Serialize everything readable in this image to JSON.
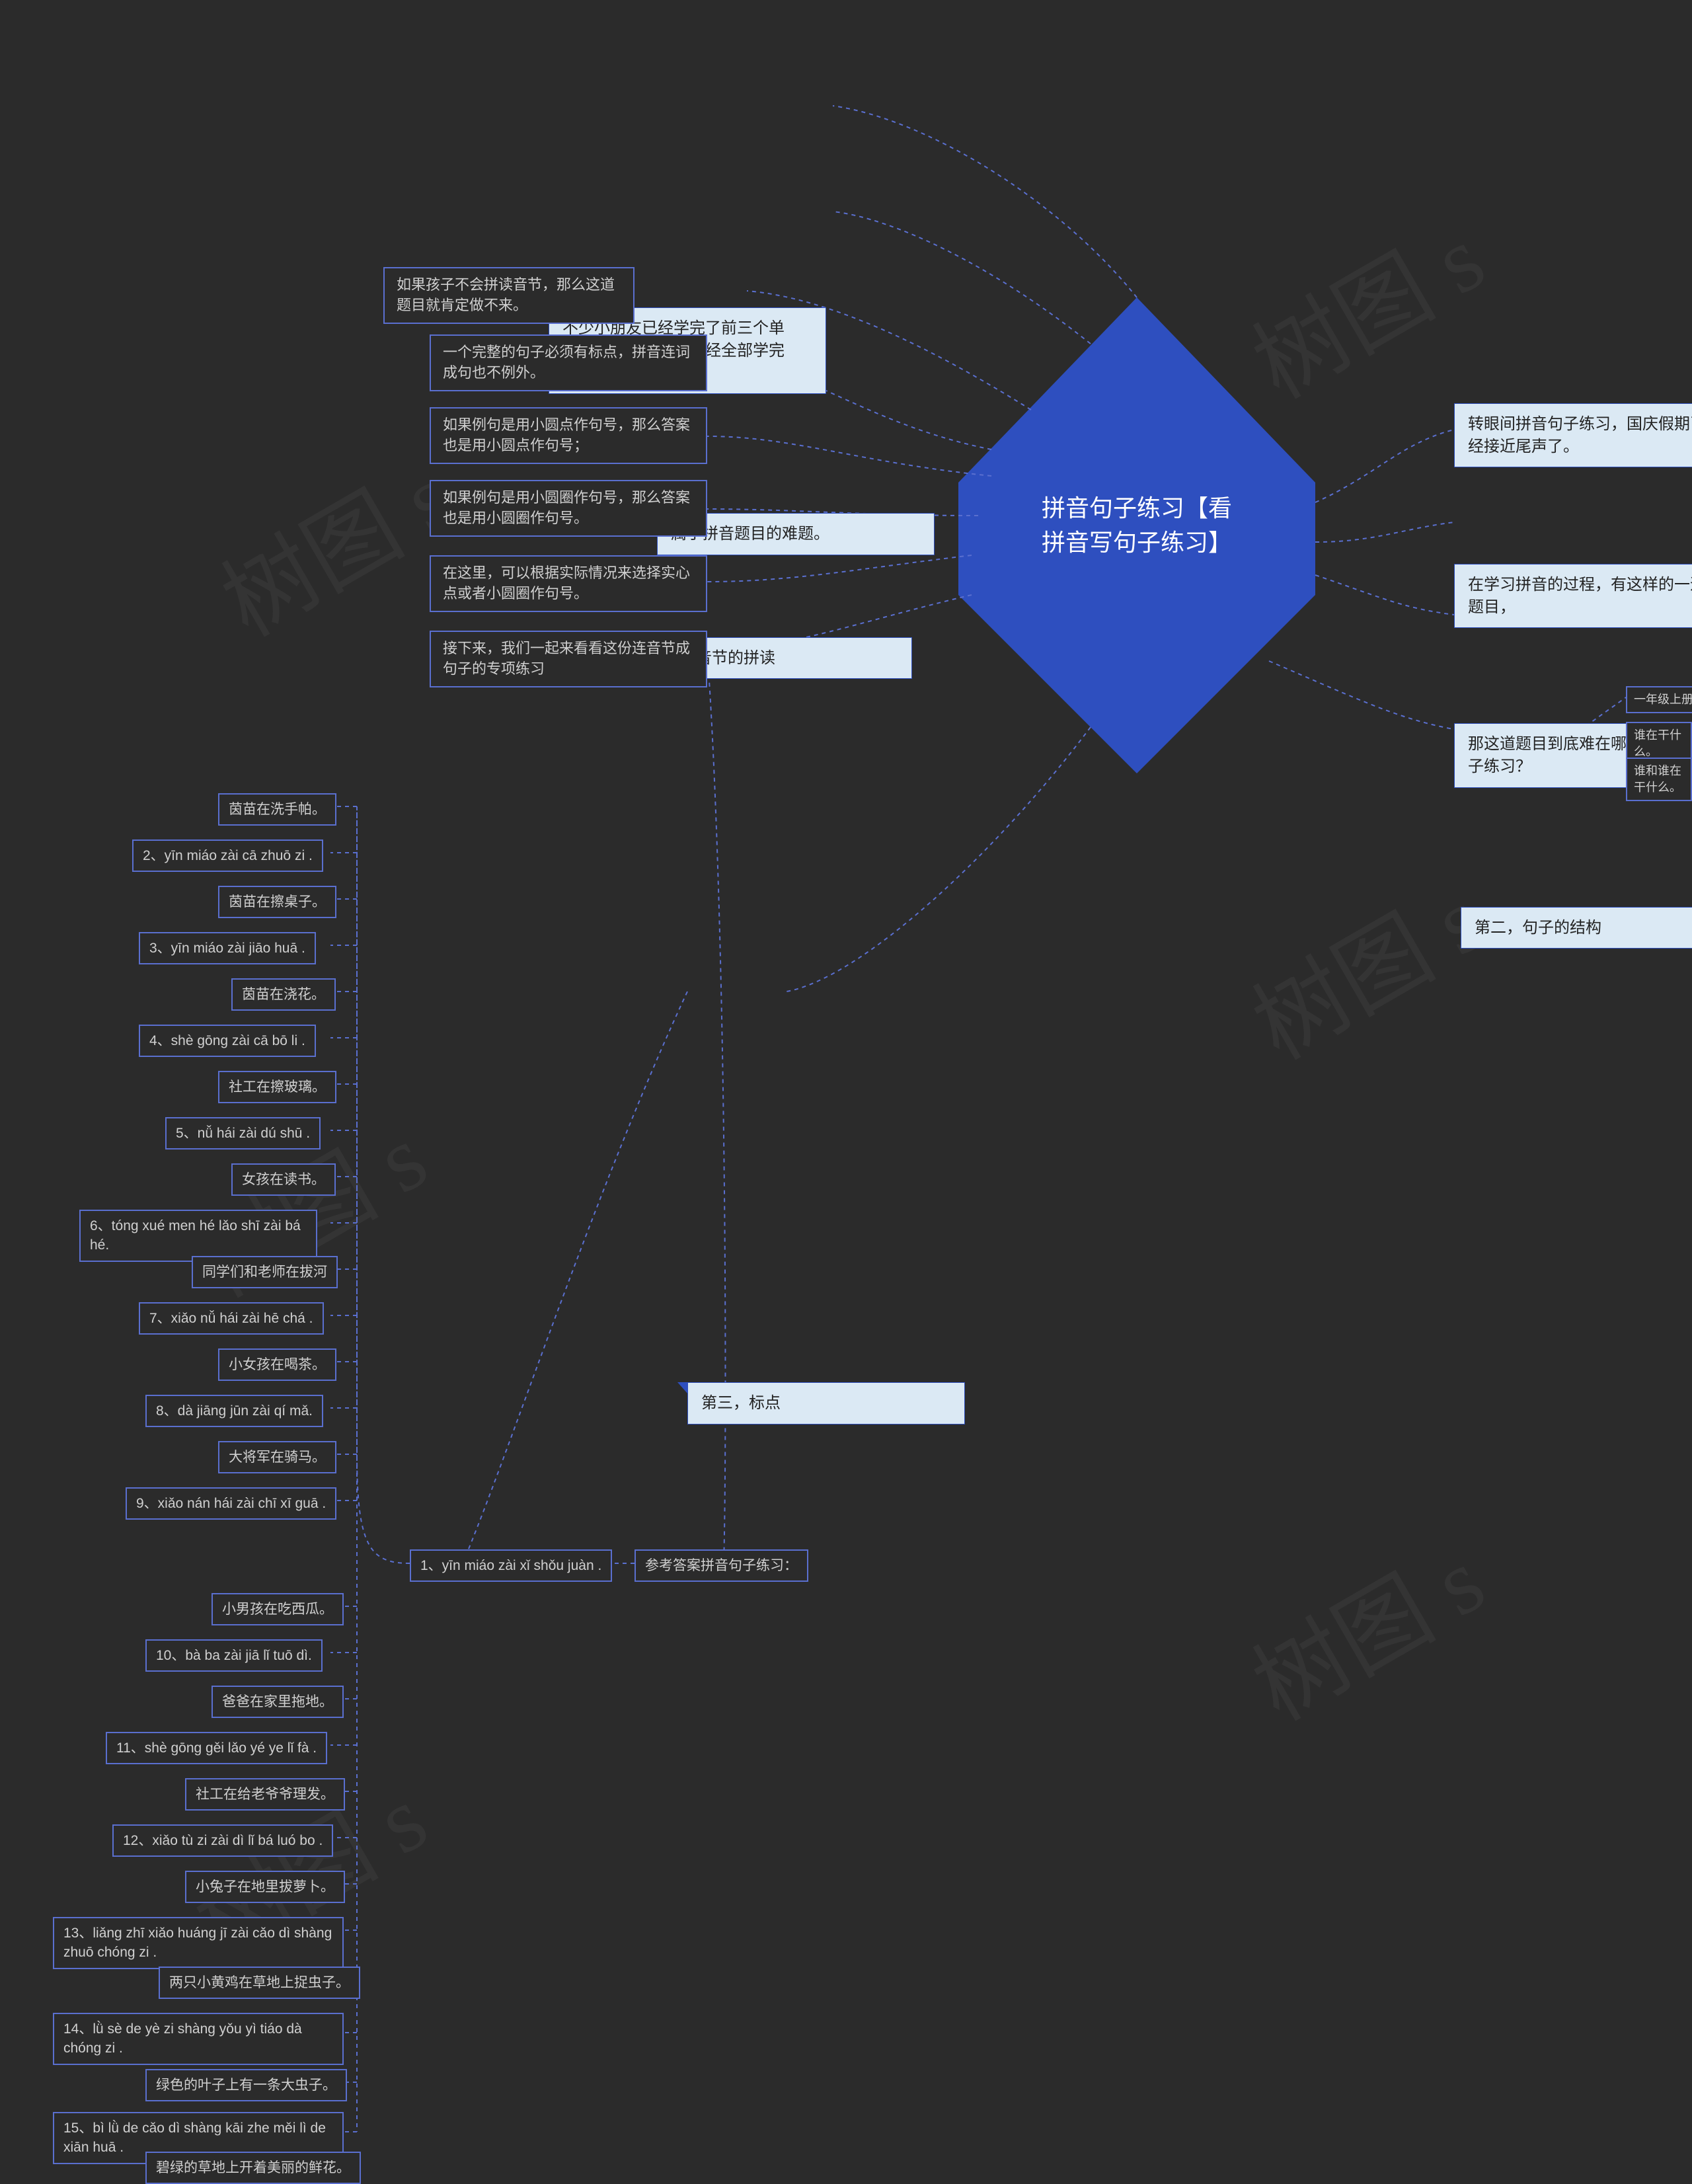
{
  "center": "拼音句子练习【看拼音写句子练习】",
  "right": {
    "r1": "转眼间拼音句子练习，国庆假期已经接近尾声了。",
    "r2": "在学习拼音的过程，有这样的一道题目，",
    "r3": "那这道题目到底难在哪里呢拼音句子练习？",
    "r4": "第二，句子的结构",
    "r4a": "一年级上册最主要的句式就是",
    "r4b": "谁在干什么。",
    "r4c": "谁和谁在干什么。"
  },
  "top": {
    "t1": "不少小朋友已经学完了前三个单元，换言之，拼音已经全部学完了。",
    "t2": "属于拼音题目的难题。",
    "t3": "第一，音节的拼读",
    "t3a": "如果孩子不会拼读音节，那么这道题目就肯定做不来。"
  },
  "left": {
    "p1": "一个完整的句子必须有标点，拼音连词成句也不例外。",
    "p2": "如果例句是用小圆点作句号，那么答案也是用小圆点作句号；",
    "p3": "如果例句是用小圆圈作句号，那么答案也是用小圆圈作句号。",
    "p4": "在这里，可以根据实际情况来选择实心点或者小圆圈作句号。",
    "p5": "接下来，我们一起来看看这份连音节成句子的专项练习",
    "ref": "参考答案拼音句子练习：",
    "a1": "1、yīn miáo zài xǐ shǒu juàn .",
    "third": "第三，标点"
  },
  "answers": {
    "a1b": "茵苗在洗手帕。",
    "a2": "2、yīn miáo zài cā zhuō zi .",
    "a2b": "茵苗在擦桌子。",
    "a3": "3、yīn miáo zài jiāo huā .",
    "a3b": "茵苗在浇花。",
    "a4": "4、shè gōng zài cā bō li .",
    "a4b": "社工在擦玻璃。",
    "a5": "5、nǚ hái zài dú shū .",
    "a5b": "女孩在读书。",
    "a6": "6、tóng xué men hé lǎo shī zài bá hé.",
    "a6b": "同学们和老师在拔河",
    "a7": "7、xiǎo nǚ hái zài hē chá .",
    "a7b": "小女孩在喝茶。",
    "a8": "8、dà jiāng jūn zài qí mǎ.",
    "a8b": "大将军在骑马。",
    "a9": "9、xiǎo nán hái zài chī xī guā .",
    "a9b": "小男孩在吃西瓜。",
    "a10": "10、bà ba zài jiā lǐ tuō dì.",
    "a10b": "爸爸在家里拖地。",
    "a11": "11、shè gōng gěi lǎo yé ye lǐ fà .",
    "a11b": "社工在给老爷爷理发。",
    "a12": "12、xiǎo tù zi zài dì lǐ bá luó bo .",
    "a12b": "小兔子在地里拔萝卜。",
    "a13": "13、liǎng zhī xiǎo huáng jī zài cǎo dì shàng zhuō chóng zi .",
    "a13b": "两只小黄鸡在草地上捉虫子。",
    "a14": "14、lǜ sè de yè zi shàng yǒu yì tiáo dà chóng zi .",
    "a14b": "绿色的叶子上有一条大虫子。",
    "a15": "15、bì lǜ de cǎo dì shàng kāi zhe měi lì de xiān huā .",
    "a15b": "碧绿的草地上开着美丽的鲜花。"
  },
  "watermark": "树图 s"
}
